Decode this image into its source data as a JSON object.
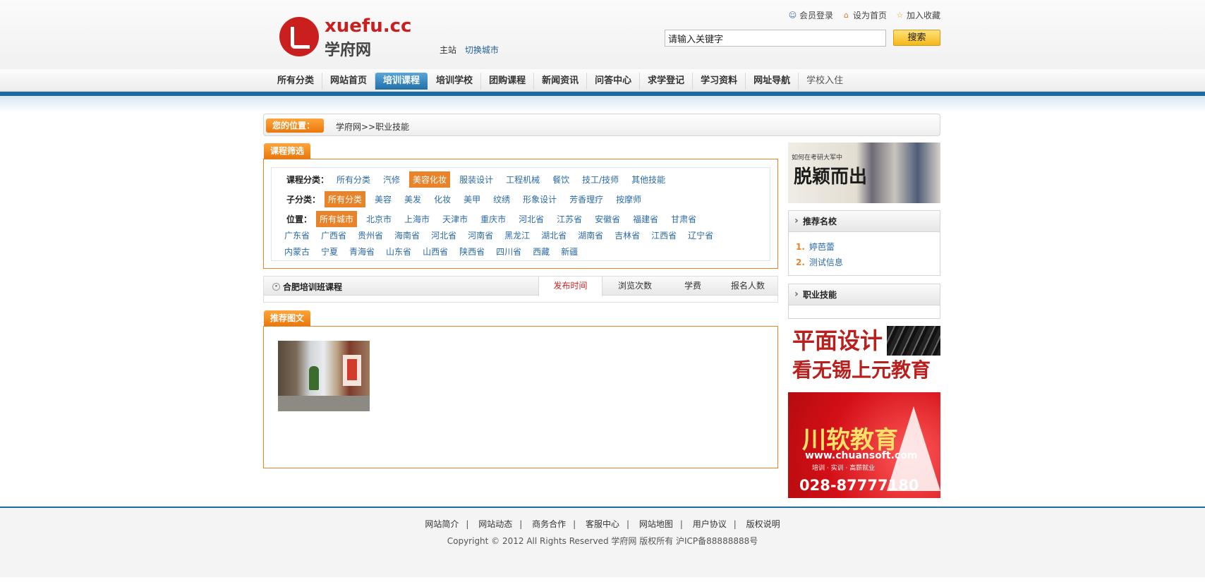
{
  "logo": {
    "brand": "xuefu.cc",
    "brand_cn": "学府网"
  },
  "site": {
    "main": "主站",
    "switch_city": "切换城市"
  },
  "top_links": {
    "login": "会员登录",
    "set_home": "设为首页",
    "favorite": "加入收藏"
  },
  "search": {
    "value": "请输入关键字",
    "button": "搜索"
  },
  "nav": {
    "items": [
      "所有分类",
      "网站首页",
      "培训课程",
      "培训学校",
      "团购课程",
      "新闻资讯",
      "问答中心",
      "求学登记",
      "学习资料",
      "网址导航",
      "学校入住"
    ],
    "active": "培训课程"
  },
  "breadcrumb": {
    "label": "您的位置：",
    "path": "学府网>>职业技能"
  },
  "filter": {
    "tab": "课程筛选",
    "category_label": "课程分类：",
    "categories": [
      "所有分类",
      "汽修",
      "美容化妆",
      "服装设计",
      "工程机械",
      "餐饮",
      "技工/技师",
      "其他技能"
    ],
    "category_selected": "美容化妆",
    "sub_label": "子分类：",
    "subs": [
      "所有分类",
      "美容",
      "美发",
      "化妆",
      "美甲",
      "纹绣",
      "形象设计",
      "芳香理疗",
      "按摩师"
    ],
    "sub_selected": "所有分类",
    "location_label": "位置：",
    "locations_row1": [
      "所有城市",
      "北京市",
      "上海市",
      "天津市",
      "重庆市",
      "河北省",
      "江苏省",
      "安徽省",
      "福建省",
      "甘肃省"
    ],
    "locations_row2": [
      "广东省",
      "广西省",
      "贵州省",
      "海南省",
      "河北省",
      "河南省",
      "黑龙江",
      "湖北省",
      "湖南省",
      "吉林省",
      "江西省",
      "辽宁省"
    ],
    "locations_row3": [
      "内蒙古",
      "宁夏",
      "青海省",
      "山东省",
      "山西省",
      "陕西省",
      "四川省",
      "西藏",
      "新疆"
    ],
    "location_selected": "所有城市"
  },
  "listing": {
    "title": "合肥培训班课程",
    "sorts": [
      "发布时间",
      "浏览次数",
      "学费",
      "报名人数"
    ],
    "sort_active": "发布时间"
  },
  "recommend": {
    "tab": "推荐图文"
  },
  "sidebar": {
    "ad1_text": "如何在考研大军中",
    "ad1_headline": "脱颖而出",
    "schools_title": "推荐名校",
    "schools": [
      {
        "rank": "1.",
        "name": "婷芭蕾"
      },
      {
        "rank": "2.",
        "name": "测试信息"
      }
    ],
    "skills_title": "职业技能",
    "ad2_line1": "平面设计",
    "ad2_line2": "看无锡上元教育",
    "ad3_title": "川软教育",
    "ad3_url": "www.chuansoft.com",
    "ad3_slogan": "培训 · 实训 · 高薪就业",
    "ad3_phone": "028-87777180"
  },
  "footer": {
    "links": [
      "网站简介",
      "网站动态",
      "商务合作",
      "客服中心",
      "网站地图",
      "用户协议",
      "版权说明"
    ],
    "copyright": "Copyright © 2012 All Rights Reserved 学府网 版权所有 沪ICP备88888888号"
  },
  "colors": {
    "accent": "#e8832a",
    "nav_blue": "#1e6b9f",
    "brand_red": "#c9201f",
    "link": "#2c6aa6"
  }
}
